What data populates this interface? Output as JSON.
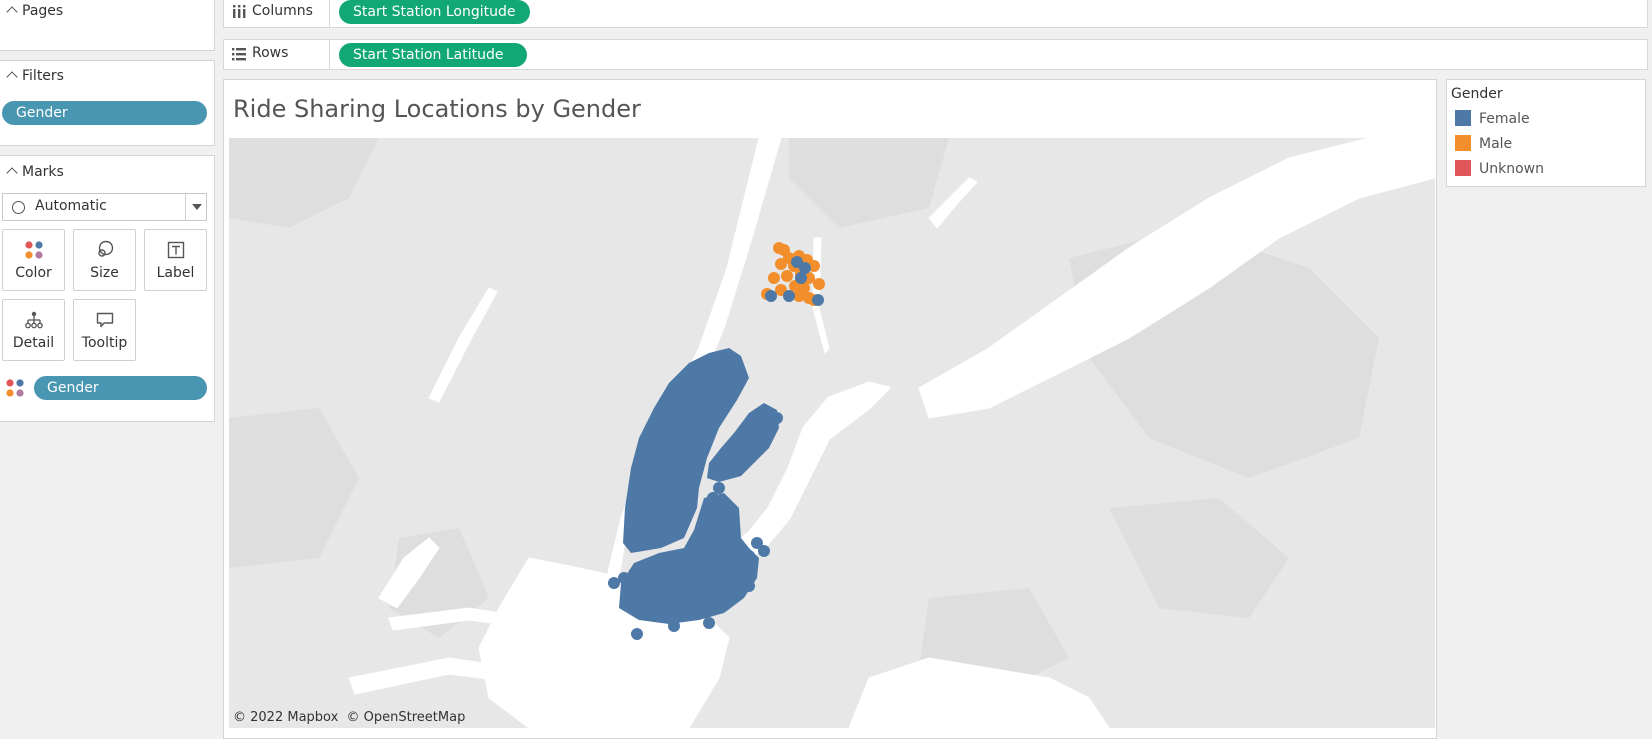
{
  "pages": {
    "title": "Pages"
  },
  "filters": {
    "title": "Filters",
    "pill": "Gender"
  },
  "marks": {
    "title": "Marks",
    "type_select": "Automatic",
    "buttons": {
      "color": "Color",
      "size": "Size",
      "label": "Label",
      "detail": "Detail",
      "tooltip": "Tooltip"
    },
    "color_pill": "Gender"
  },
  "shelves": {
    "columns_label": "Columns",
    "columns_pill": "Start Station Longitude",
    "rows_label": "Rows",
    "rows_pill": "Start Station Latitude"
  },
  "view": {
    "title": "Ride Sharing Locations by Gender",
    "attribution": "© 2022 Mapbox  © OpenStreetMap"
  },
  "legend": {
    "title": "Gender",
    "items": [
      {
        "label": "Female",
        "color": "#4e79a7"
      },
      {
        "label": "Male",
        "color": "#f28e2b"
      },
      {
        "label": "Unknown",
        "color": "#e15759"
      }
    ]
  },
  "colors": {
    "pill_blue": "#4996b2",
    "pill_green": "#12a876",
    "map_land": "#e8e8e8",
    "map_water": "#ffffff"
  }
}
